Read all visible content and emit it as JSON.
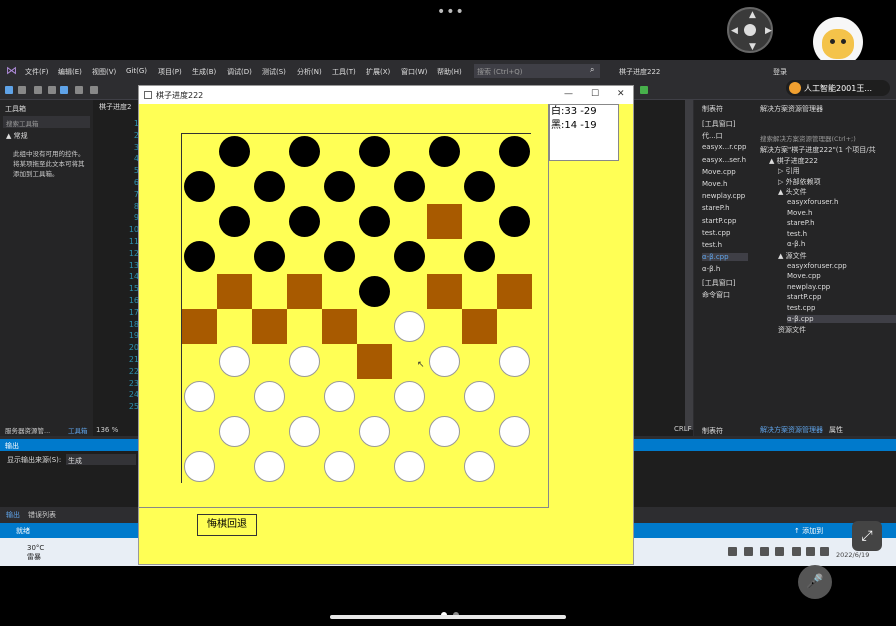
{
  "overlay": {
    "dots": "•••",
    "assistant_name": "人工智能2001王..."
  },
  "vs": {
    "menu": [
      "文件(F)",
      "编辑(E)",
      "视图(V)",
      "Git(G)",
      "项目(P)",
      "生成(B)",
      "调试(D)",
      "测试(S)",
      "分析(N)",
      "工具(T)",
      "扩展(X)",
      "窗口(W)",
      "帮助(H)"
    ],
    "search_placeholder": "搜索 (Ctrl+Q)",
    "solution_title": "棋子进度222",
    "login": "登录",
    "toolbox": {
      "title": "工具箱",
      "search": "搜索工具箱",
      "group": "▲ 常规",
      "hint": "此组中没有可用的控件。将某项拖至此文本可将其添加到工具箱。"
    },
    "editor": {
      "tab": "棋子进度2",
      "zoom": "136 %",
      "line_numbers": [
        "1",
        "2",
        "3",
        "4",
        "5",
        "6",
        "7",
        "8",
        "9",
        "10",
        "11",
        "12",
        "13",
        "14",
        "15",
        "16",
        "17",
        "18",
        "19",
        "20",
        "21",
        "22",
        "23",
        "24",
        "25"
      ],
      "crlf": "CRLF"
    },
    "bottom_tabs": [
      "服务器资源管...",
      "工具箱"
    ],
    "col2": {
      "title": "制表符",
      "items": [
        "[工具窗口]",
        "代...口",
        "easyx...r.cpp",
        "easyx...ser.h",
        "Move.cpp",
        "Move.h",
        "newplay.cpp",
        "stareP.h",
        "startP.cpp",
        "test.cpp",
        "test.h",
        "α-β.cpp",
        "α-β.h",
        "[工具窗口]",
        "命令窗口"
      ],
      "footer": "制表符"
    },
    "solution_explorer": {
      "title": "解决方案资源管理器",
      "search": "搜索解决方案资源管理器(Ctrl+;)",
      "items": [
        {
          "text": "解决方案\"棋子进度222\"(1 个项目/共",
          "indent": 0
        },
        {
          "text": "▲ 棋子进度222",
          "indent": 1
        },
        {
          "text": "▷ 引用",
          "indent": 2
        },
        {
          "text": "▷ 外部依赖项",
          "indent": 2
        },
        {
          "text": "▲ 头文件",
          "indent": 2
        },
        {
          "text": "easyxforuser.h",
          "indent": 3
        },
        {
          "text": "Move.h",
          "indent": 3
        },
        {
          "text": "stareP.h",
          "indent": 3
        },
        {
          "text": "test.h",
          "indent": 3
        },
        {
          "text": "α-β.h",
          "indent": 3
        },
        {
          "text": "▲ 源文件",
          "indent": 2
        },
        {
          "text": "easyxforuser.cpp",
          "indent": 3
        },
        {
          "text": "Move.cpp",
          "indent": 3
        },
        {
          "text": "newplay.cpp",
          "indent": 3
        },
        {
          "text": "startP.cpp",
          "indent": 3
        },
        {
          "text": "test.cpp",
          "indent": 3
        },
        {
          "text": "α-β.cpp",
          "indent": 3
        },
        {
          "text": "资源文件",
          "indent": 2
        }
      ],
      "footer": [
        "解决方案资源管理器",
        "属性"
      ]
    },
    "output": {
      "title": "输出",
      "source_label": "显示输出来源(S):",
      "source_value": "生成",
      "tabs": [
        "输出",
        "错误列表"
      ]
    },
    "status": {
      "left": "就绪",
      "right": "↑ 添加到"
    }
  },
  "taskbar": {
    "temp": "30°C",
    "weather": "雷暴",
    "date": "2022/6/19"
  },
  "game": {
    "title": "棋子进度222",
    "score_white": "白:33 -29",
    "score_black": "黑:14 -19",
    "undo_label": "悔棋回退",
    "colors": {
      "board_light": "#ffff55",
      "board_dark": "#a85a00"
    },
    "board": [
      "-b-b-b-b-b",
      "b-b-b-b-b-",
      "-b-b-b-D-b",
      "b-b-b-b-b-",
      "-D-D-b-D-D",
      "D-D-D-w-D-",
      "-w-w-D-w-w",
      "w-w-w-w-w-",
      "-w-w-w-w-w",
      "w-w-w-w-w-"
    ]
  }
}
